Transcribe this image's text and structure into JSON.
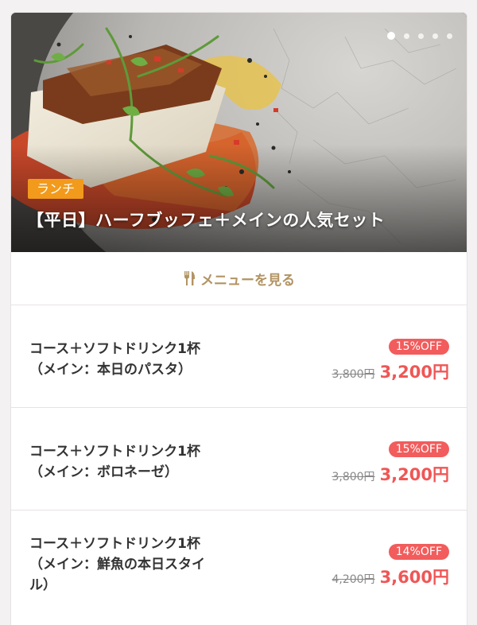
{
  "hero": {
    "image": "grilled-fish-dish-photo",
    "badge": "ランチ",
    "title": "【平日】ハーフブッフェ＋メインの人気セット",
    "carousel": {
      "count": 5,
      "active_index": 0
    }
  },
  "menu_link": {
    "icon": "fork-knife-icon",
    "label": "メニューを見る"
  },
  "plans": [
    {
      "name_line1": "コース＋ソフトドリンク1杯",
      "name_line2": "（メイン：本日のパスタ）",
      "name_line3": "",
      "discount": "15%OFF",
      "original_price": "3,800円",
      "price": "3,200円"
    },
    {
      "name_line1": "コース＋ソフトドリンク1杯",
      "name_line2": "（メイン：ボロネーゼ）",
      "name_line3": "",
      "discount": "15%OFF",
      "original_price": "3,800円",
      "price": "3,200円"
    },
    {
      "name_line1": "コース＋ソフトドリンク1杯",
      "name_line2": "（メイン：鮮魚の本日スタイ",
      "name_line3": "ル）",
      "discount": "14%OFF",
      "original_price": "4,200円",
      "price": "3,600円"
    }
  ],
  "colors": {
    "accent_gold": "#b29463",
    "badge_orange": "#f29a1b",
    "sale_red": "#f05656"
  }
}
